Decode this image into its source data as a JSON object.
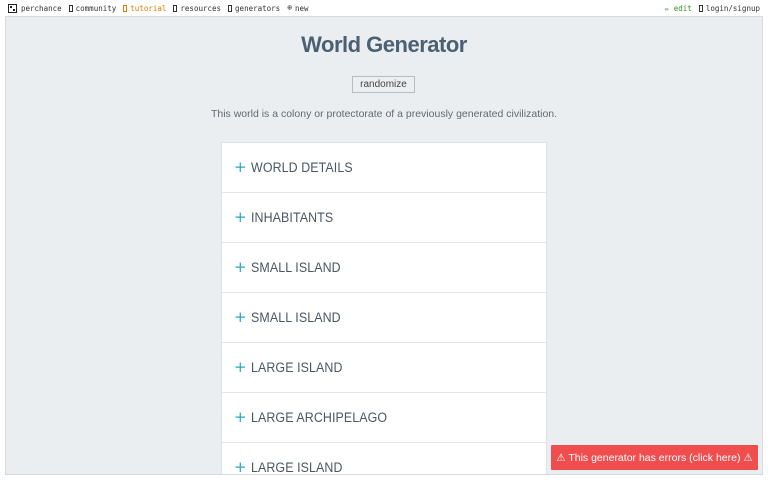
{
  "topbar": {
    "left": [
      {
        "label": "perchance",
        "icon": "die-icon"
      },
      {
        "label": "community",
        "icon": "chat-icon"
      },
      {
        "label": "tutorial",
        "icon": "book-icon"
      },
      {
        "label": "resources",
        "icon": "box-icon"
      },
      {
        "label": "generators",
        "icon": "list-icon"
      },
      {
        "label": "new",
        "icon": "plus-circle-icon"
      }
    ],
    "edit": "✏ edit",
    "login": "login/signup"
  },
  "main": {
    "title": "World Generator",
    "randomize": "randomize",
    "description": "This world is a colony or protectorate of a previously generated civilization.",
    "sections": [
      "WORLD DETAILS",
      "INHABITANTS",
      "SMALL ISLAND",
      "SMALL ISLAND",
      "LARGE ISLAND",
      "LARGE ARCHIPELAGO",
      "LARGE ISLAND"
    ],
    "plus_glyph": "+"
  },
  "error": "⚠ This generator has errors (click here) ⚠",
  "colors": {
    "accent": "#2aa5c8",
    "title": "#4b6072",
    "error_bg": "#f04e4e",
    "tutorial": "#e07b00",
    "edit": "#2f8f2f"
  }
}
